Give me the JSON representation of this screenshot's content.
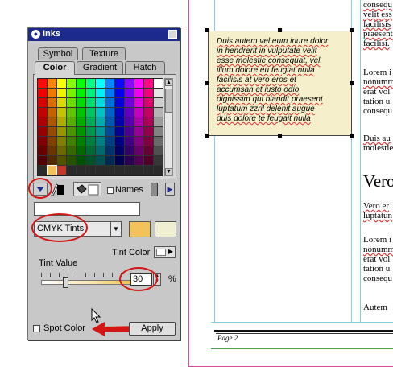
{
  "document": {
    "frame_text": "Duis autem vel eum iriure dolor\nin hendrerit in vulputate velit\nesse molestie consequat, vel\nillum dolore eu feugiat nulla\nfacilisis at vero eros et\naccumsan et iusto odio\ndignissim qui blandit praesent\nluptatum zzril delenit augue\nduis dolore te feugait nulla",
    "column_lines": [
      "consequ",
      "velit ess",
      "facilisis",
      "praesent",
      "facilisi."
    ],
    "column_lines_2": [
      "Lorem i",
      "nonumm",
      "erat vol",
      "tation u",
      "consequ"
    ],
    "column_lines_3": [
      "Duis au",
      "molestie"
    ],
    "heading": "Vero",
    "column_lines_4": [
      "Vero er",
      "luptatun"
    ],
    "column_lines_5": [
      "Lorem i",
      "nonumm",
      "erat vol",
      "tation u",
      "consequ"
    ],
    "column_lines_6": [
      "Autem"
    ],
    "footer_label": "Page 2"
  },
  "palette": {
    "title": "Inks",
    "tabs_row1": [
      "Symbol",
      "Texture"
    ],
    "tabs_row2": [
      "Color",
      "Gradient",
      "Hatch"
    ],
    "active_tab": "Color",
    "names_label": "Names",
    "tint_select": "CMYK Tints",
    "tint_color_label": "Tint Color",
    "tint_value_label": "Tint Value",
    "tint_value": "30",
    "percent": "%",
    "spot_color_label": "Spot Color",
    "apply_label": "Apply",
    "chip_colors": {
      "primary": "#f2c35a",
      "secondary": "#f1efd2"
    },
    "accent": "#1b2a8c",
    "annotation_color": "#d41616"
  }
}
